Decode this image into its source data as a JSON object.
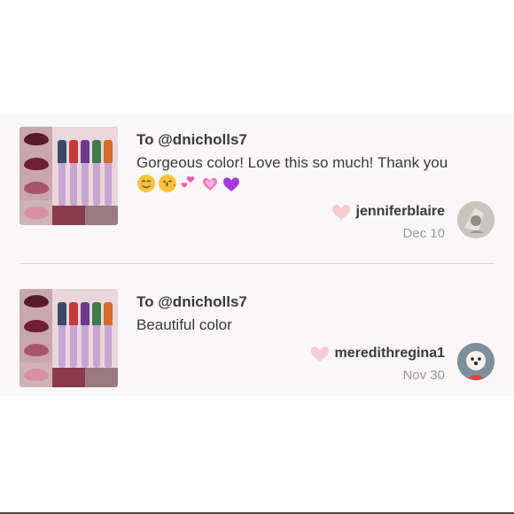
{
  "reviews": [
    {
      "to": "To @dnicholls7",
      "message": "Gorgeous color! Love this so much! Thank you",
      "emojis": [
        "smiling-face-icon",
        "kissing-face-icon",
        "two-hearts-icon",
        "sparkling-heart-icon",
        "purple-heart-icon"
      ],
      "username": "jenniferblaire",
      "date": "Dec 10"
    },
    {
      "to": "To @dnicholls7",
      "message": "Beautiful color",
      "emojis": [],
      "username": "meredithregina1",
      "date": "Nov 30"
    }
  ],
  "colors": {
    "heart": "#f7cdd0",
    "panel_background": "#faf7f8",
    "divider": "#dcd6d8",
    "date_text": "#9a9a9a"
  }
}
